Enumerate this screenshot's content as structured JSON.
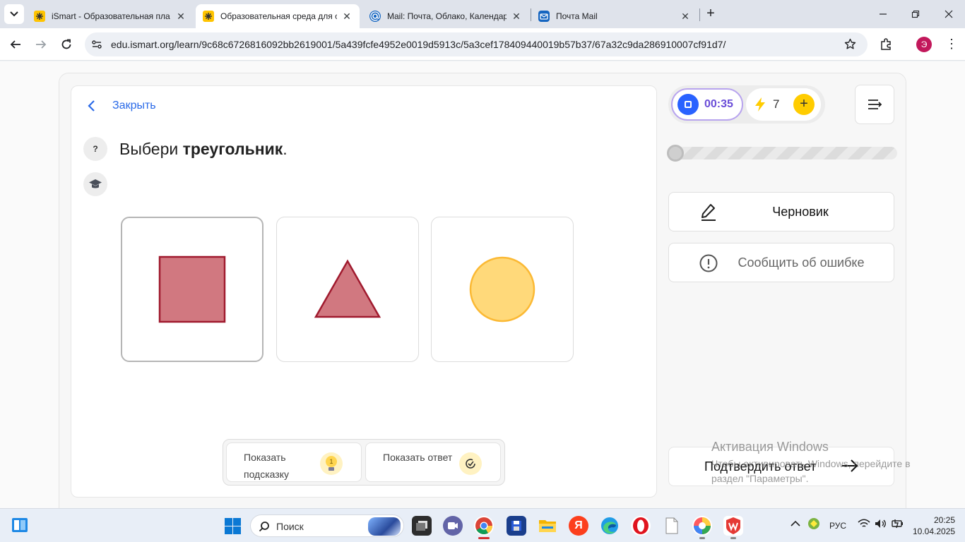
{
  "browser": {
    "tabs": [
      {
        "title": "iSmart - Образовательная пла",
        "active": false
      },
      {
        "title": "Образовательная среда для с",
        "active": true
      },
      {
        "title": "Mail: Почта, Облако, Календар",
        "active": false
      },
      {
        "title": "Почта Mail",
        "active": false
      }
    ],
    "url": "edu.ismart.org/learn/9c68c6726816092bb2619001/5a439fcfe4952e0019d5913c/5a3cef178409440019b57b37/67a32c9da286910007cf91d7/",
    "profile_initial": "Э"
  },
  "lesson": {
    "close_label": "Закрыть",
    "help_label": "?",
    "task_prefix": "Выбери ",
    "task_bold": "треугольник",
    "task_suffix": ".",
    "options": [
      {
        "shape": "square",
        "color": "#d17880",
        "selected": true
      },
      {
        "shape": "triangle",
        "color": "#d17880",
        "selected": false
      },
      {
        "shape": "circle",
        "color": "#ffd97a",
        "selected": false
      }
    ],
    "hint_button": "Показать подсказку",
    "hint_count": "1",
    "answer_button": "Показать ответ"
  },
  "side": {
    "timer": "00:35",
    "energy": "7",
    "progress": 0,
    "draft_label": "Черновик",
    "report_label": "Сообщить об ошибке",
    "submit_label": "Подтвердить ответ"
  },
  "watermark": {
    "title": "Активация Windows",
    "text": "Чтобы активировать Windows, перейдите в раздел \"Параметры\"."
  },
  "taskbar": {
    "search_label": "Поиск",
    "lang": "РУС",
    "time": "20:25",
    "date": "10.04.2025"
  },
  "colors": {
    "accent_blue": "#2a6ae8",
    "timer_purple": "#6a4dd8",
    "energy_yellow": "#ffcc00",
    "shape_red": "#d17880",
    "shape_yellow": "#ffd97a"
  }
}
